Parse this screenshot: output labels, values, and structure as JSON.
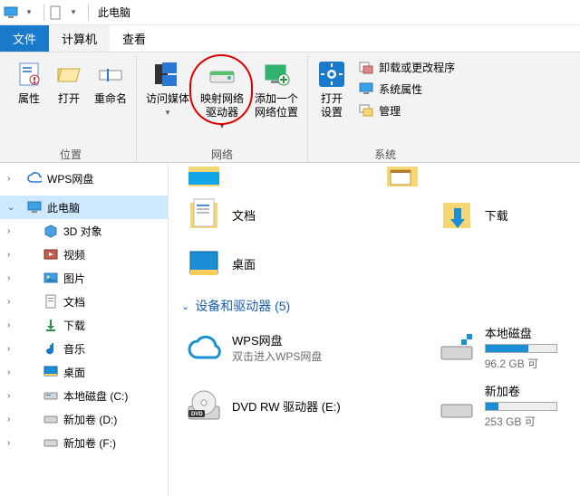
{
  "titlebar": {
    "title": "此电脑"
  },
  "tabs": {
    "file": "文件",
    "computer": "计算机",
    "view": "查看"
  },
  "ribbon": {
    "group_location": "位置",
    "group_network": "网络",
    "group_system": "系统",
    "properties": "属性",
    "open": "打开",
    "rename": "重命名",
    "access_media_l1": "访问媒体",
    "map_drive_l1": "映射网络",
    "map_drive_l2": "驱动器",
    "add_net_l1": "添加一个",
    "add_net_l2": "网络位置",
    "open_settings_l1": "打开",
    "open_settings_l2": "设置",
    "uninstall": "卸载或更改程序",
    "sys_props": "系统属性",
    "manage": "管理"
  },
  "nav": {
    "wps": "WPS网盘",
    "thispc": "此电脑",
    "objects3d": "3D 对象",
    "videos": "视频",
    "pictures": "图片",
    "documents": "文档",
    "downloads": "下载",
    "music": "音乐",
    "desktop": "桌面",
    "drive_c": "本地磁盘 (C:)",
    "drive_d": "新加卷 (D:)",
    "drive_f": "新加卷 (F:)"
  },
  "content": {
    "documents": "文档",
    "downloads": "下载",
    "desktop": "桌面",
    "section": "设备和驱动器 (5)",
    "wps_title": "WPS网盘",
    "wps_sub": "双击进入WPS网盘",
    "localdisk_title": "本地磁盘",
    "localdisk_sub": "96.2 GB 可",
    "dvd_title": "DVD RW 驱动器 (E:)",
    "newvol_title": "新加卷",
    "newvol_sub": "253 GB 可"
  }
}
